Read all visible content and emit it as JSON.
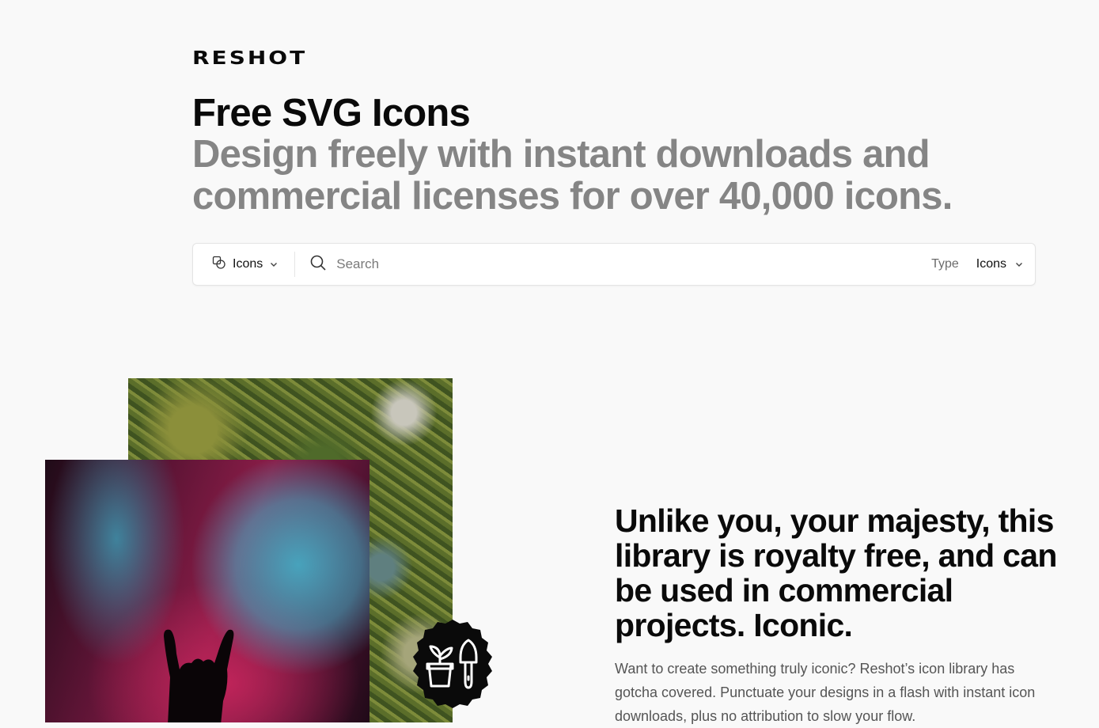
{
  "brand": {
    "logo_text": "RESHOT"
  },
  "hero": {
    "title": "Free SVG Icons",
    "subtitle": "Design freely with instant downloads and commercial licenses for over 40,000 icons."
  },
  "search": {
    "type_select_label": "Icons",
    "placeholder": "Search",
    "filter_label": "Type",
    "filter_value": "Icons"
  },
  "feature": {
    "title": "Unlike you, your majesty, this library is royalty free, and can be used in commercial projects. Iconic.",
    "body": "Want to create something truly iconic? Reshot’s icon library has gotcha covered. Punctuate your designs in a flash with instant icon downloads, plus no attribution to slow your flow."
  },
  "icons": {
    "type_select": "shapes-icon",
    "search": "search-icon",
    "chevron": "chevron-down-icon",
    "badge": "plant-pot-trowel-icon"
  },
  "colors": {
    "background": "#f9f9f9",
    "text_primary": "#0a0a0a",
    "text_muted": "#858585",
    "badge": "#0a0a0a"
  }
}
